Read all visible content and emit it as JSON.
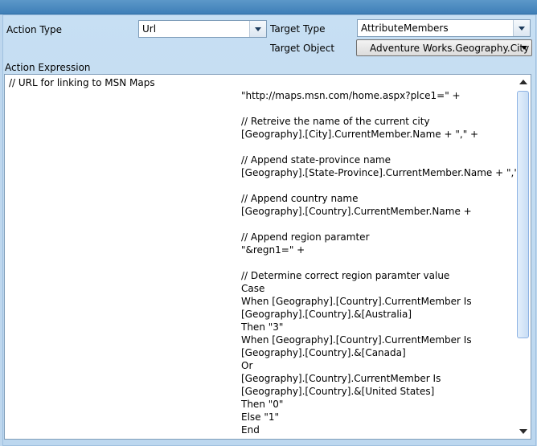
{
  "form": {
    "action_type_label": "Action Type",
    "action_type_value": "Url",
    "target_type_label": "Target Type",
    "target_type_value": "AttributeMembers",
    "target_object_label": "Target Object",
    "target_object_value": "Adventure Works.Geography.City",
    "action_expression_label": "Action Expression"
  },
  "icons": {
    "dropdown": "chevron-down-icon",
    "scroll_up": "arrow-up-icon",
    "scroll_down": "arrow-down-icon"
  },
  "editor": {
    "lines": [
      {
        "indent": 0,
        "text": "// URL for linking to MSN Maps"
      },
      {
        "indent": 1,
        "text": "\"http://maps.msn.com/home.aspx?plce1=\" +"
      },
      {
        "indent": 1,
        "text": ""
      },
      {
        "indent": 1,
        "text": "// Retreive the name of the current city"
      },
      {
        "indent": 1,
        "text": "[Geography].[City].CurrentMember.Name + \",\" +"
      },
      {
        "indent": 1,
        "text": ""
      },
      {
        "indent": 1,
        "text": "// Append state-province name"
      },
      {
        "indent": 1,
        "text": "[Geography].[State-Province].CurrentMember.Name + \",\" +"
      },
      {
        "indent": 1,
        "text": ""
      },
      {
        "indent": 1,
        "text": "// Append country name"
      },
      {
        "indent": 1,
        "text": "[Geography].[Country].CurrentMember.Name +"
      },
      {
        "indent": 1,
        "text": ""
      },
      {
        "indent": 1,
        "text": "// Append region paramter"
      },
      {
        "indent": 1,
        "text": "\"&regn1=\" +"
      },
      {
        "indent": 1,
        "text": ""
      },
      {
        "indent": 1,
        "text": "// Determine correct region paramter value"
      },
      {
        "indent": 1,
        "text": "Case"
      },
      {
        "indent": 1,
        "text": "When [Geography].[Country].CurrentMember Is"
      },
      {
        "indent": 1,
        "text": "[Geography].[Country].&[Australia]"
      },
      {
        "indent": 1,
        "text": "Then \"3\""
      },
      {
        "indent": 1,
        "text": "When [Geography].[Country].CurrentMember Is"
      },
      {
        "indent": 1,
        "text": "[Geography].[Country].&[Canada]"
      },
      {
        "indent": 1,
        "text": "Or"
      },
      {
        "indent": 1,
        "text": "[Geography].[Country].CurrentMember Is"
      },
      {
        "indent": 1,
        "text": "[Geography].[Country].&[United States]"
      },
      {
        "indent": 1,
        "text": "Then \"0\""
      },
      {
        "indent": 1,
        "text": "Else \"1\""
      },
      {
        "indent": 1,
        "text": "End"
      }
    ]
  }
}
